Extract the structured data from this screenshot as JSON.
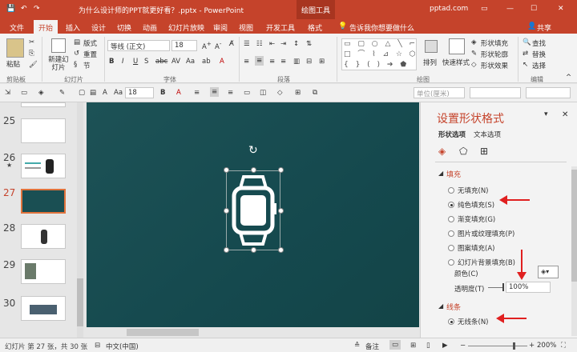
{
  "titlebar": {
    "doc_title": "为什么设计师的PPT就更好看？.pptx - PowerPoint",
    "tool_context": "绘图工具",
    "brand": "pptad.com",
    "share": "共享"
  },
  "tabs": [
    {
      "label": "文件"
    },
    {
      "label": "开始"
    },
    {
      "label": "插入"
    },
    {
      "label": "设计"
    },
    {
      "label": "切换"
    },
    {
      "label": "动画"
    },
    {
      "label": "幻灯片放映"
    },
    {
      "label": "审阅"
    },
    {
      "label": "视图"
    },
    {
      "label": "开发工具"
    },
    {
      "label": "格式"
    }
  ],
  "tell_me": "告诉我你想要做什么",
  "ribbon": {
    "clipboard": {
      "paste": "粘贴",
      "label": "剪贴板"
    },
    "slides": {
      "new_slide": "新建幻灯片",
      "layout": "版式",
      "reset": "重置",
      "section": "节",
      "label": "幻灯片"
    },
    "font": {
      "name": "等线 (正文)",
      "size": "18",
      "label": "字体"
    },
    "paragraph": {
      "label": "段落"
    },
    "drawing": {
      "arrange": "排列",
      "quick_styles": "快速样式",
      "fill": "形状填充",
      "outline": "形状轮廓",
      "effects": "形状效果",
      "label": "绘图"
    },
    "editing": {
      "find": "查找",
      "replace": "替换",
      "select": "选择",
      "label": "编辑"
    }
  },
  "minibar": {
    "font_size": "18",
    "width_placeholder": "单位(厘米)"
  },
  "thumbnails": [
    {
      "num": "25"
    },
    {
      "num": "26",
      "star": "★"
    },
    {
      "num": "27"
    },
    {
      "num": "28"
    },
    {
      "num": "29"
    },
    {
      "num": "30"
    }
  ],
  "pane": {
    "title": "设置形状格式",
    "tab_shape": "形状选项",
    "tab_text": "文本选项",
    "fill_header": "填充",
    "fill_options": [
      "无填充(N)",
      "纯色填充(S)",
      "渐变填充(G)",
      "图片或纹理填充(P)",
      "图案填充(A)",
      "幻灯片背景填充(B)"
    ],
    "selected_fill": "纯色填充(S)",
    "color_label": "颜色(C)",
    "transparency_label": "透明度(T)",
    "transparency_value": "100%",
    "line_header": "线条",
    "line_option": "无线条(N)"
  },
  "status": {
    "slide_info": "幻灯片 第 27 张，共 30 张",
    "language": "中文(中国)",
    "notes": "备注",
    "zoom": "200%"
  },
  "colors": {
    "accent": "#c5432b",
    "canvas": "#1a4f53",
    "arrow": "#e02020"
  }
}
